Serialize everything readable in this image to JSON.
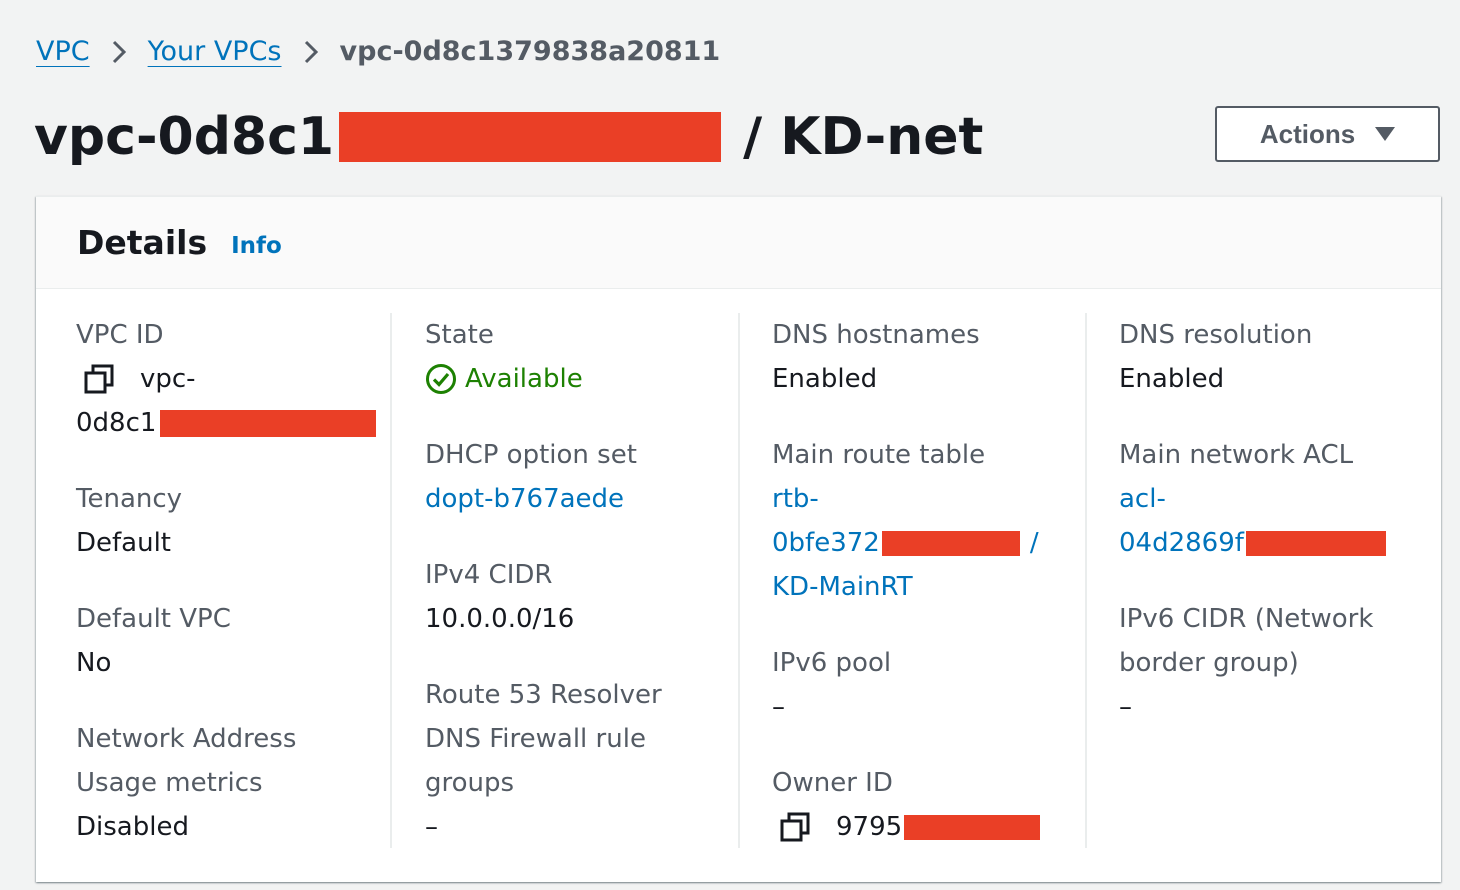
{
  "breadcrumb": {
    "root": "VPC",
    "list": "Your VPCs",
    "current": "vpc-0d8c1379838a20811"
  },
  "header": {
    "title_prefix": "vpc-0d8c1",
    "title_suffix": "/ KD-net",
    "actions_label": "Actions"
  },
  "details": {
    "title": "Details",
    "info_link": "Info",
    "vpc_id": {
      "label": "VPC ID",
      "value_line1": "vpc-",
      "value_line2": "0d8c1"
    },
    "tenancy": {
      "label": "Tenancy",
      "value": "Default"
    },
    "default_vpc": {
      "label": "Default VPC",
      "value": "No"
    },
    "nau_metrics": {
      "label_line1": "Network Address",
      "label_line2": "Usage metrics",
      "value": "Disabled"
    },
    "state": {
      "label": "State",
      "value": "Available"
    },
    "dhcp": {
      "label": "DHCP option set",
      "value": "dopt-b767aede"
    },
    "ipv4_cidr": {
      "label": "IPv4 CIDR",
      "value": "10.0.0.0/16"
    },
    "route53": {
      "label_line1": "Route 53 Resolver",
      "label_line2": "DNS Firewall rule",
      "label_line3": "groups",
      "value": "–"
    },
    "dns_hostnames": {
      "label": "DNS hostnames",
      "value": "Enabled"
    },
    "main_route_table": {
      "label": "Main route table",
      "value_line1": "rtb-",
      "value_line2": "0bfe372",
      "value_line2_tail": "/",
      "value_line3": "KD-MainRT"
    },
    "ipv6_pool": {
      "label": "IPv6 pool",
      "value": "–"
    },
    "owner_id": {
      "label": "Owner ID",
      "value": "9795"
    },
    "dns_resolution": {
      "label": "DNS resolution",
      "value": "Enabled"
    },
    "main_acl": {
      "label": "Main network ACL",
      "value_line1": "acl-",
      "value_line2": "04d2869f"
    },
    "ipv6_cidr": {
      "label_line1": "IPv6 CIDR (Network",
      "label_line2": "border group)",
      "value": "–"
    }
  },
  "colors": {
    "link": "#0073bb",
    "success": "#1d8102",
    "redaction": "#ea3f26"
  },
  "icons": [
    "chevron-right-icon",
    "caret-down-icon",
    "copy-icon",
    "status-success-icon"
  ]
}
